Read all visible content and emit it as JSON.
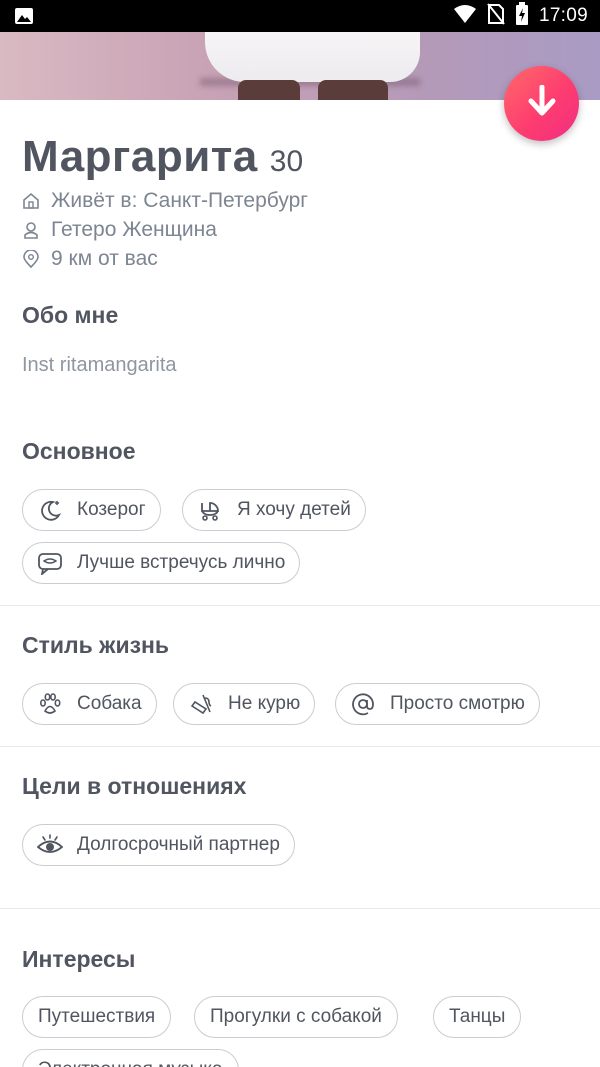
{
  "status_bar": {
    "time": "17:09"
  },
  "profile": {
    "name": "Маргарита",
    "age": "30",
    "lives_in": "Живёт в: Санкт-Петербург",
    "orientation": "Гетеро Женщина",
    "distance": "9 км от вас"
  },
  "about": {
    "title": "Обо мне",
    "text": "Inst ritamangarita"
  },
  "basics": {
    "title": "Основное",
    "chips": [
      {
        "label": "Козерог",
        "icon": "moon-icon"
      },
      {
        "label": "Я хочу детей",
        "icon": "baby-stroller-icon"
      },
      {
        "label": "Лучше встречусь лично",
        "icon": "chat-bubble-icon"
      }
    ]
  },
  "lifestyle": {
    "title": "Стиль жизнь",
    "chips": [
      {
        "label": "Собака",
        "icon": "paw-icon"
      },
      {
        "label": "Не курю",
        "icon": "no-smoking-icon"
      },
      {
        "label": "Просто смотрю",
        "icon": "at-sign-icon"
      }
    ]
  },
  "goals": {
    "title": "Цели в отношениях",
    "chips": [
      {
        "label": "Долгосрочный партнер",
        "icon": "eye-icon"
      }
    ]
  },
  "interests": {
    "title": "Интересы",
    "chips": [
      {
        "label": "Путешествия"
      },
      {
        "label": "Прогулки с собакой"
      },
      {
        "label": "Танцы"
      },
      {
        "label": "Электронная музыка"
      }
    ]
  },
  "colors": {
    "accent_gradient_start": "#ff6a6a",
    "accent_gradient_end": "#f12d82",
    "text_dark": "#505560",
    "text_muted": "#7c8591",
    "chip_border": "#c9cdd3"
  }
}
